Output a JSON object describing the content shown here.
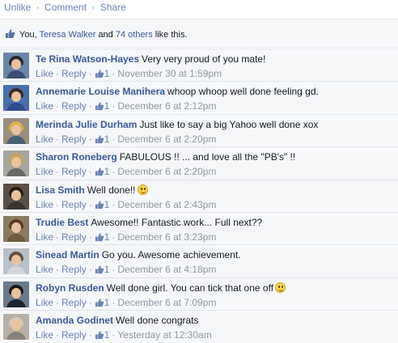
{
  "actions": {
    "unlike": "Unlike",
    "comment": "Comment",
    "share": "Share",
    "sep": "·"
  },
  "likes_bar": {
    "you": "You,",
    "friend": "Teresa Walker",
    "and": "and",
    "others": "74 others",
    "suffix": "like this."
  },
  "comment_actions": {
    "like": "Like",
    "reply": "Reply",
    "sep": "·"
  },
  "comments": [
    {
      "author": "Te Rina Watson-Hayes",
      "text": "Very very proud of you mate!",
      "likes": "1",
      "time": "November 30 at 1:59pm",
      "emoji": ""
    },
    {
      "author": "Annemarie Louise Manihera",
      "text": "whoop whoop well done feeling gd.",
      "likes": "1",
      "time": "December 6 at 2:12pm",
      "emoji": ""
    },
    {
      "author": "Merinda Julie Durham",
      "text": "Just like to say a big Yahoo well done xox",
      "likes": "1",
      "time": "December 6 at 2:20pm",
      "emoji": ""
    },
    {
      "author": "Sharon Roneberg",
      "text": "FABULOUS !! ... and love all the \"PB's\" !!",
      "likes": "1",
      "time": "December 6 at 2:20pm",
      "emoji": ""
    },
    {
      "author": "Lisa Smith",
      "text": "Well done!!",
      "likes": "1",
      "time": "December 6 at 2:43pm",
      "emoji": "smile"
    },
    {
      "author": "Trudie Best",
      "text": "Awesome!! Fantastic work... Full next??",
      "likes": "1",
      "time": "December 6 at 3:23pm",
      "emoji": ""
    },
    {
      "author": "Sinead Martin",
      "text": "Go you. Awesome achievement.",
      "likes": "1",
      "time": "December 6 at 4:18pm",
      "emoji": ""
    },
    {
      "author": "Robyn Rusden",
      "text": "Well done girl. You can tick that one off",
      "likes": "1",
      "time": "December 6 at 7:09pm",
      "emoji": "smile"
    },
    {
      "author": "Amanda Godinet",
      "text": "Well done congrats",
      "likes": "1",
      "time": "Yesterday at 12:30am",
      "emoji": ""
    }
  ],
  "avatar_colors": [
    {
      "bg": "#6b86a8",
      "hair": "#2a2a2a",
      "body": "#3d4e7a"
    },
    {
      "bg": "#4a6fa8",
      "hair": "#3b2a1a",
      "body": "#2d4d8a"
    },
    {
      "bg": "#9a8e7e",
      "hair": "#d9b24a",
      "body": "#4a6070"
    },
    {
      "bg": "#a8a49e",
      "hair": "#c9a25a",
      "body": "#6a6a6a"
    },
    {
      "bg": "#5a5048",
      "hair": "#2a1e16",
      "body": "#3a3430"
    },
    {
      "bg": "#8a7a62",
      "hair": "#5a3a22",
      "body": "#705a40"
    },
    {
      "bg": "#b8c0c8",
      "hair": "#6a5040",
      "body": "#d0d6dc"
    },
    {
      "bg": "#6a7a8a",
      "hair": "#1a1a1a",
      "body": "#1e2430"
    },
    {
      "bg": "#b8b0a8",
      "hair": "#d8c8b8",
      "body": "#8a8078"
    }
  ]
}
